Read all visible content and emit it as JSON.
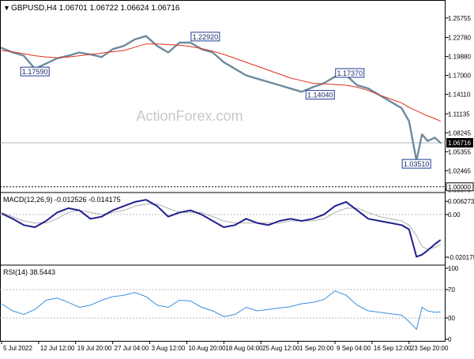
{
  "header": {
    "symbol_line": "GBPUSD,H4  1.06701 1.06722 1.06624 1.06716",
    "watermark": "ActionForex.com"
  },
  "colors": {
    "price_bars": "#6f8a9c",
    "moving_average": "#e0301e",
    "macd_line": "#1f1f8f",
    "signal_line": "#b0b0b0",
    "rsi_line": "#3a8fe0",
    "grid": "#b8b8b8",
    "annotation_border": "#1f3a93",
    "current_price_box": "#000000"
  },
  "chart_data": [
    {
      "type": "line",
      "name": "price_panel",
      "ylim": [
        0.9937,
        1.2802
      ],
      "y_ticks": [
        "1.25755",
        "1.22780",
        "1.19880",
        "1.17000",
        "1.14110",
        "1.11135",
        "1.08245",
        "1.05355",
        "1.02465",
        "0.99575"
      ],
      "current_price_label": "1.06716",
      "level_line_label": "1.00000",
      "level_line_value": 1.0,
      "annotations": [
        {
          "label": "1.17590",
          "x": 0.9,
          "y": 1.1759
        },
        {
          "label": "1.22920",
          "x": 5.5,
          "y": 1.2292
        },
        {
          "label": "1.17370",
          "x": 9.4,
          "y": 1.1737
        },
        {
          "label": "1.14040",
          "x": 8.6,
          "y": 1.1404
        },
        {
          "label": "1.03510",
          "x": 11.2,
          "y": 1.0351
        }
      ],
      "x": [
        0,
        0.3,
        0.6,
        0.9,
        1.2,
        1.5,
        1.8,
        2.1,
        2.4,
        2.7,
        3.0,
        3.3,
        3.6,
        3.9,
        4.2,
        4.5,
        4.8,
        5.1,
        5.4,
        5.7,
        6.0,
        6.3,
        6.6,
        6.9,
        7.2,
        7.5,
        7.8,
        8.1,
        8.4,
        8.7,
        9.0,
        9.3,
        9.6,
        9.9,
        10.2,
        10.5,
        10.8,
        11.0,
        11.2,
        11.35,
        11.5,
        11.7,
        11.85
      ],
      "series": [
        {
          "values": [
            1.212,
            1.205,
            1.2,
            1.18,
            1.188,
            1.196,
            1.2,
            1.205,
            1.202,
            1.198,
            1.21,
            1.215,
            1.225,
            1.23,
            1.215,
            1.205,
            1.22,
            1.22,
            1.21,
            1.205,
            1.19,
            1.18,
            1.17,
            1.165,
            1.16,
            1.155,
            1.15,
            1.145,
            1.152,
            1.158,
            1.168,
            1.17,
            1.155,
            1.15,
            1.14,
            1.13,
            1.12,
            1.1,
            1.04,
            1.08,
            1.07,
            1.075,
            1.067
          ]
        },
        {
          "values": [
            1.208,
            1.206,
            1.203,
            1.2,
            1.198,
            1.197,
            1.198,
            1.2,
            1.202,
            1.204,
            1.206,
            1.208,
            1.213,
            1.218,
            1.218,
            1.217,
            1.216,
            1.214,
            1.211,
            1.207,
            1.202,
            1.196,
            1.19,
            1.184,
            1.178,
            1.172,
            1.166,
            1.162,
            1.158,
            1.157,
            1.156,
            1.155,
            1.152,
            1.147,
            1.14,
            1.134,
            1.128,
            1.121,
            1.116,
            1.112,
            1.108,
            1.104,
            1.1
          ]
        }
      ]
    },
    {
      "type": "line",
      "name": "macd_panel",
      "title": "MACD(12,26,9) -0.012526 -0.014175",
      "ylim": [
        -0.0232,
        0.0082
      ],
      "y_ticks": [
        "0.006273",
        "0.00",
        "-0.020175"
      ],
      "x": [
        0,
        0.3,
        0.6,
        0.9,
        1.2,
        1.5,
        1.8,
        2.1,
        2.4,
        2.7,
        3.0,
        3.3,
        3.6,
        3.9,
        4.2,
        4.5,
        4.8,
        5.1,
        5.4,
        5.7,
        6.0,
        6.3,
        6.6,
        6.9,
        7.2,
        7.5,
        7.8,
        8.1,
        8.4,
        8.7,
        9.0,
        9.3,
        9.6,
        9.9,
        10.2,
        10.5,
        10.8,
        11.0,
        11.2,
        11.35,
        11.5,
        11.7,
        11.85
      ],
      "series": [
        {
          "values": [
            0.0005,
            -0.002,
            -0.005,
            -0.006,
            -0.003,
            0.001,
            0.003,
            0.002,
            -0.002,
            -0.001,
            0.002,
            0.004,
            0.006,
            0.007,
            0.004,
            -0.001,
            0.001,
            0.002,
            0.0,
            -0.003,
            -0.006,
            -0.005,
            -0.002,
            -0.004,
            -0.005,
            -0.003,
            -0.002,
            -0.003,
            -0.002,
            0.0,
            0.004,
            0.006,
            0.002,
            -0.002,
            -0.003,
            -0.004,
            -0.005,
            -0.007,
            -0.02,
            -0.019,
            -0.017,
            -0.014,
            -0.012
          ]
        },
        {
          "values": [
            0.001,
            -0.001,
            -0.003,
            -0.004,
            -0.004,
            -0.002,
            0.001,
            0.002,
            0.001,
            0.0,
            0.001,
            0.002,
            0.004,
            0.005,
            0.005,
            0.003,
            0.001,
            0.001,
            0.001,
            -0.001,
            -0.003,
            -0.004,
            -0.004,
            -0.004,
            -0.004,
            -0.004,
            -0.003,
            -0.003,
            -0.003,
            -0.002,
            0.001,
            0.003,
            0.003,
            0.001,
            -0.001,
            -0.002,
            -0.003,
            -0.005,
            -0.01,
            -0.015,
            -0.0165,
            -0.0155,
            -0.0142
          ]
        }
      ]
    },
    {
      "type": "line",
      "name": "rsi_panel",
      "title": "RSI(14) 38.5443",
      "ylim": [
        0,
        100
      ],
      "y_ticks": [
        "100",
        "70",
        "30",
        "0"
      ],
      "levels": [
        70,
        30
      ],
      "x_tick_labels": [
        "5 Jul 2022",
        "12 Jul 12:00",
        "19 Jul 20:00",
        "27 Jul 04:00",
        "3 Aug 12:00",
        "10 Aug 20:00",
        "18 Aug 04:00",
        "25 Aug 12:00",
        "1 Sep 20:00",
        "9 Sep 04:00",
        "16 Sep 12:00",
        "23 Sep 20:00"
      ],
      "x": [
        0,
        0.3,
        0.6,
        0.9,
        1.2,
        1.5,
        1.8,
        2.1,
        2.4,
        2.7,
        3.0,
        3.3,
        3.6,
        3.9,
        4.2,
        4.5,
        4.8,
        5.1,
        5.4,
        5.7,
        6.0,
        6.3,
        6.6,
        6.9,
        7.2,
        7.5,
        7.8,
        8.1,
        8.4,
        8.7,
        9.0,
        9.3,
        9.6,
        9.9,
        10.2,
        10.5,
        10.8,
        11.0,
        11.2,
        11.35,
        11.5,
        11.7,
        11.85
      ],
      "series": [
        {
          "values": [
            50,
            40,
            35,
            42,
            55,
            58,
            52,
            45,
            48,
            55,
            60,
            62,
            66,
            60,
            48,
            45,
            55,
            54,
            45,
            40,
            32,
            35,
            45,
            40,
            42,
            44,
            46,
            50,
            52,
            56,
            68,
            62,
            48,
            40,
            38,
            36,
            34,
            25,
            14,
            45,
            40,
            38,
            38.5
          ]
        }
      ]
    }
  ]
}
